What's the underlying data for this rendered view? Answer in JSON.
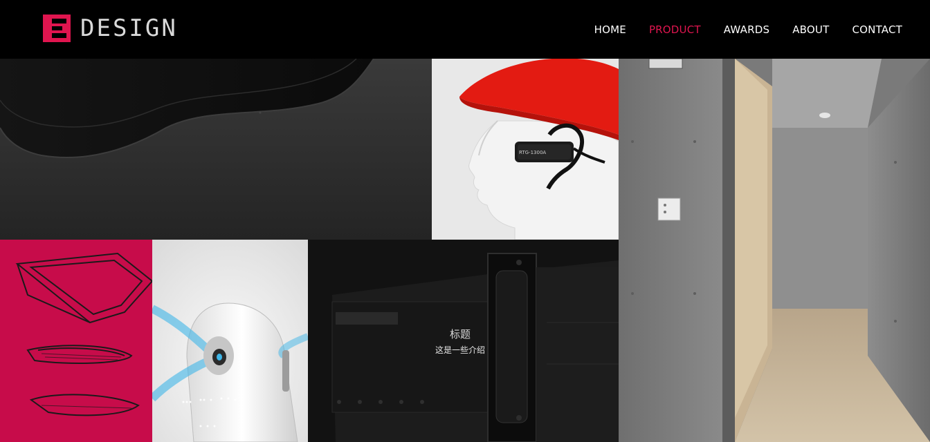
{
  "header": {
    "logo_text": "DESIGN",
    "brand_color": "#e0154f",
    "nav": [
      {
        "label": "HOME",
        "active": false
      },
      {
        "label": "PRODUCT",
        "active": true
      },
      {
        "label": "AWARDS",
        "active": false
      },
      {
        "label": "ABOUT",
        "active": false
      },
      {
        "label": "CONTACT",
        "active": false
      }
    ]
  },
  "gallery": {
    "overlay": {
      "title": "标题",
      "subtitle": "这是一些介绍"
    },
    "helmet_device_label": "RTG-1300A"
  }
}
